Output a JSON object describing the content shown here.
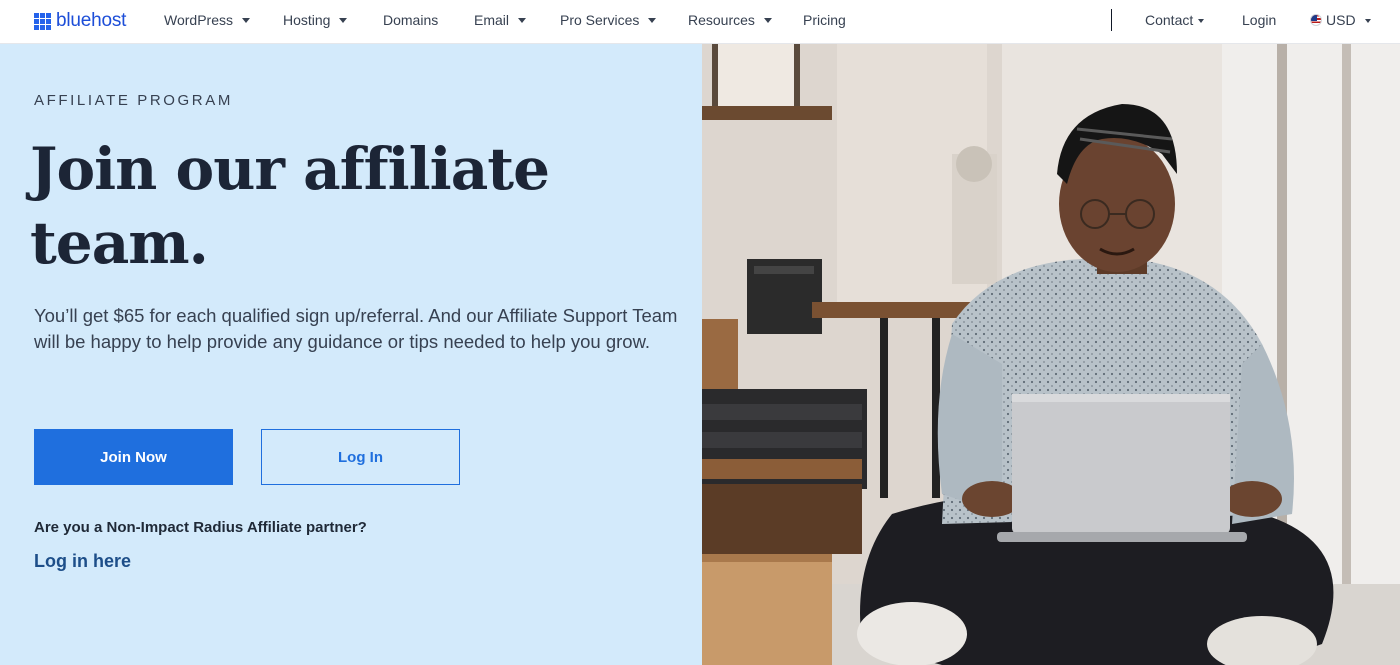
{
  "header": {
    "logo_text": "bluehost",
    "nav": [
      {
        "label": "WordPress",
        "has_dropdown": true
      },
      {
        "label": "Hosting",
        "has_dropdown": true
      },
      {
        "label": "Domains",
        "has_dropdown": false
      },
      {
        "label": "Email",
        "has_dropdown": true
      },
      {
        "label": "Pro Services",
        "has_dropdown": true
      },
      {
        "label": "Resources",
        "has_dropdown": true
      },
      {
        "label": "Pricing",
        "has_dropdown": false
      }
    ],
    "contact_label": "Contact",
    "login_label": "Login",
    "currency_label": "USD"
  },
  "hero": {
    "eyebrow": "AFFILIATE PROGRAM",
    "headline": "Join our affiliate team.",
    "description": "You’ll get $65 for each qualified sign up/referral. And our Affiliate Support Team will be happy to help provide any guidance or tips needed to help you grow.",
    "join_button": "Join Now",
    "login_button": "Log In",
    "partner_question": "Are you a Non-Impact Radius Affiliate partner?",
    "partner_link": "Log in here"
  },
  "colors": {
    "brand_blue": "#1f6fde",
    "hero_background": "#d3eafb",
    "headline_navy": "#1c2536",
    "link_navy": "#1d4e89"
  },
  "icons": [
    "bluehost-logo-icon",
    "chevron-down-icon",
    "us-flag-icon"
  ]
}
